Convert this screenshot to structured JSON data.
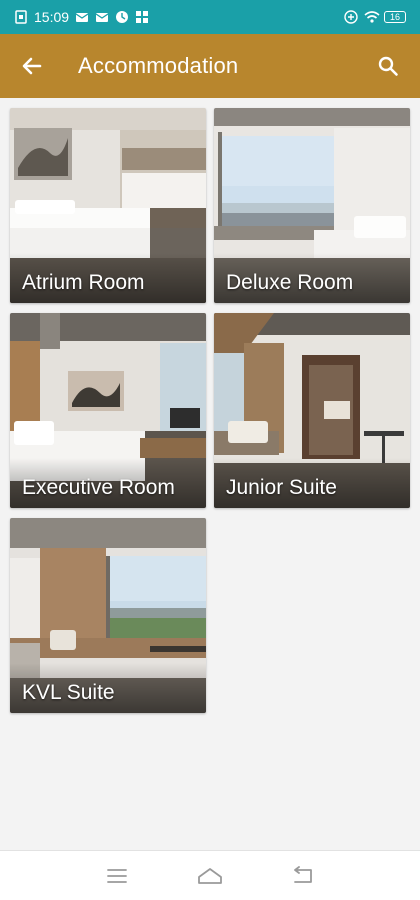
{
  "status_bar": {
    "time": "15:09",
    "battery": "16",
    "left_icons": [
      "file-icon",
      "mail-icon",
      "mail-icon",
      "clock-icon",
      "grid-icon"
    ],
    "right_icons": [
      "vibrate-icon",
      "wifi-icon",
      "battery-icon"
    ]
  },
  "app_bar": {
    "title": "Accommodation",
    "back_icon": "arrow-left-icon",
    "search_icon": "search-icon",
    "background": "#b8862d"
  },
  "rooms": [
    {
      "name": "Atrium Room"
    },
    {
      "name": "Deluxe Room"
    },
    {
      "name": "Executive Room"
    },
    {
      "name": "Junior Suite"
    },
    {
      "name": "KVL Suite"
    }
  ],
  "nav_bar": {
    "icons": [
      "menu-icon",
      "home-icon",
      "back-icon"
    ]
  }
}
